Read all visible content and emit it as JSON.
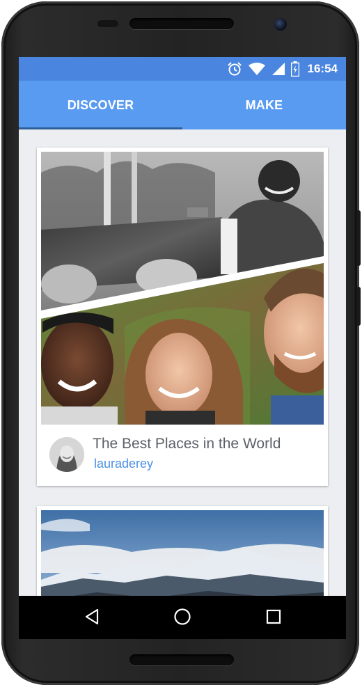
{
  "status_bar": {
    "time": "16:54",
    "icons": [
      "alarm-icon",
      "wifi-icon",
      "signal-icon",
      "battery-icon"
    ],
    "color": "#4a86df"
  },
  "tabs": [
    {
      "label": "DISCOVER",
      "selected": true
    },
    {
      "label": "MAKE",
      "selected": false
    }
  ],
  "feed": {
    "cards": [
      {
        "title": "The Best Places in the World",
        "author": "lauraderey",
        "image": "collage-photo"
      },
      {
        "title": "",
        "author": "",
        "image": "mountain-landscape-photo"
      }
    ]
  },
  "nav_bar": {
    "icons": [
      "back-icon",
      "home-icon",
      "recents-icon"
    ]
  },
  "colors": {
    "accent": "#5a9bf2",
    "link": "#4a90e2",
    "background": "#edeef2"
  }
}
